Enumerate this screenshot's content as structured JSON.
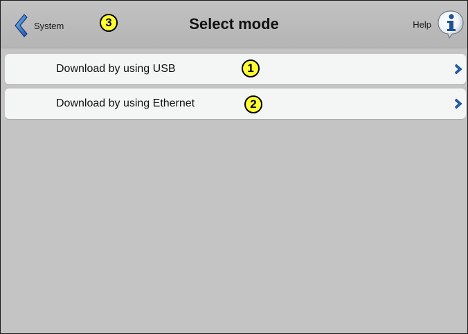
{
  "header": {
    "back_label": "System",
    "title": "Select mode",
    "help_label": "Help",
    "back_icon": "chevron-left-icon",
    "help_icon": "info-icon"
  },
  "menu": {
    "items": [
      {
        "label": "Download by using USB",
        "marker": "1"
      },
      {
        "label": "Download by using Ethernet",
        "marker": "2"
      }
    ],
    "chevron_icon": "chevron-right-icon"
  },
  "callouts": {
    "header_marker": "3"
  },
  "colors": {
    "background": "#c4c4c4",
    "header": "#b8b8b8",
    "item_background": "#f3f6f5",
    "accent_blue": "#1f64b8",
    "marker_yellow": "#ffff33"
  }
}
